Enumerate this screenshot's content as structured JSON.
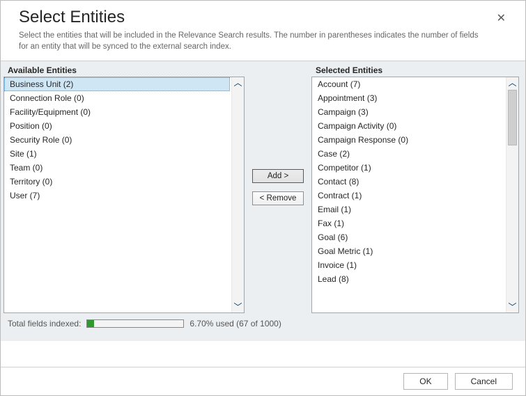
{
  "header": {
    "title": "Select Entities",
    "subtitle": "Select the entities that will be included in the Relevance Search results. The number in parentheses indicates the number of fields for an entity that will be synced to the external search index."
  },
  "available": {
    "heading": "Available Entities",
    "items": [
      {
        "label": "Business Unit (2)",
        "selected": true
      },
      {
        "label": "Connection Role (0)"
      },
      {
        "label": "Facility/Equipment (0)"
      },
      {
        "label": "Position (0)"
      },
      {
        "label": "Security Role (0)"
      },
      {
        "label": "Site (1)"
      },
      {
        "label": "Team (0)"
      },
      {
        "label": "Territory (0)"
      },
      {
        "label": "User (7)"
      }
    ]
  },
  "selected": {
    "heading": "Selected Entities",
    "items": [
      {
        "label": "Account (7)"
      },
      {
        "label": "Appointment (3)"
      },
      {
        "label": "Campaign (3)"
      },
      {
        "label": "Campaign Activity (0)"
      },
      {
        "label": "Campaign Response (0)"
      },
      {
        "label": "Case (2)"
      },
      {
        "label": "Competitor (1)"
      },
      {
        "label": "Contact (8)"
      },
      {
        "label": "Contract (1)"
      },
      {
        "label": "Email (1)"
      },
      {
        "label": "Fax (1)"
      },
      {
        "label": "Goal (6)"
      },
      {
        "label": "Goal Metric (1)"
      },
      {
        "label": "Invoice (1)"
      },
      {
        "label": "Lead (8)"
      }
    ]
  },
  "buttons": {
    "add": "Add >",
    "remove": "< Remove",
    "ok": "OK",
    "cancel": "Cancel"
  },
  "status": {
    "label": "Total fields indexed:",
    "text": "6.70% used (67 of 1000)",
    "percent": 6.7
  }
}
